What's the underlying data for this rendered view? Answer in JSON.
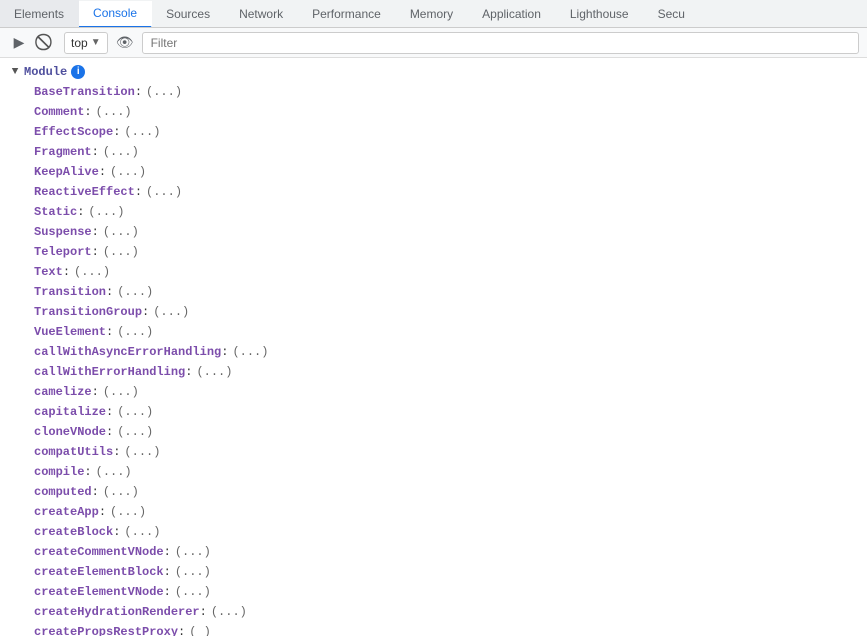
{
  "tabs": [
    {
      "id": "elements",
      "label": "Elements",
      "active": false
    },
    {
      "id": "console",
      "label": "Console",
      "active": true
    },
    {
      "id": "sources",
      "label": "Sources",
      "active": false
    },
    {
      "id": "network",
      "label": "Network",
      "active": false
    },
    {
      "id": "performance",
      "label": "Performance",
      "active": false
    },
    {
      "id": "memory",
      "label": "Memory",
      "active": false
    },
    {
      "id": "application",
      "label": "Application",
      "active": false
    },
    {
      "id": "lighthouse",
      "label": "Lighthouse",
      "active": false
    },
    {
      "id": "security",
      "label": "Secu",
      "active": false
    }
  ],
  "toolbar": {
    "top_label": "top",
    "filter_placeholder": "Filter"
  },
  "module": {
    "label": "Module",
    "properties": [
      {
        "key": "BaseTransition",
        "value": "(...)"
      },
      {
        "key": "Comment",
        "value": "(...)"
      },
      {
        "key": "EffectScope",
        "value": "(...)"
      },
      {
        "key": "Fragment",
        "value": "(...)"
      },
      {
        "key": "KeepAlive",
        "value": "(...)"
      },
      {
        "key": "ReactiveEffect",
        "value": "(...)"
      },
      {
        "key": "Static",
        "value": "(...)"
      },
      {
        "key": "Suspense",
        "value": "(...)"
      },
      {
        "key": "Teleport",
        "value": "(...)"
      },
      {
        "key": "Text",
        "value": "(...)"
      },
      {
        "key": "Transition",
        "value": "(...)"
      },
      {
        "key": "TransitionGroup",
        "value": "(...)"
      },
      {
        "key": "VueElement",
        "value": "(...)"
      },
      {
        "key": "callWithAsyncErrorHandling",
        "value": "(...)"
      },
      {
        "key": "callWithErrorHandling",
        "value": "(...)"
      },
      {
        "key": "camelize",
        "value": "(...)"
      },
      {
        "key": "capitalize",
        "value": "(...)"
      },
      {
        "key": "cloneVNode",
        "value": "(...)"
      },
      {
        "key": "compatUtils",
        "value": "(...)"
      },
      {
        "key": "compile",
        "value": "(...)"
      },
      {
        "key": "computed",
        "value": "(...)"
      },
      {
        "key": "createApp",
        "value": "(...)"
      },
      {
        "key": "createBlock",
        "value": "(...)"
      },
      {
        "key": "createCommentVNode",
        "value": "(...)"
      },
      {
        "key": "createElementBlock",
        "value": "(...)"
      },
      {
        "key": "createElementVNode",
        "value": "(...)"
      },
      {
        "key": "createHydrationRenderer",
        "value": "(...)"
      },
      {
        "key": "createPropsRestProxy",
        "value": "( )"
      }
    ]
  }
}
